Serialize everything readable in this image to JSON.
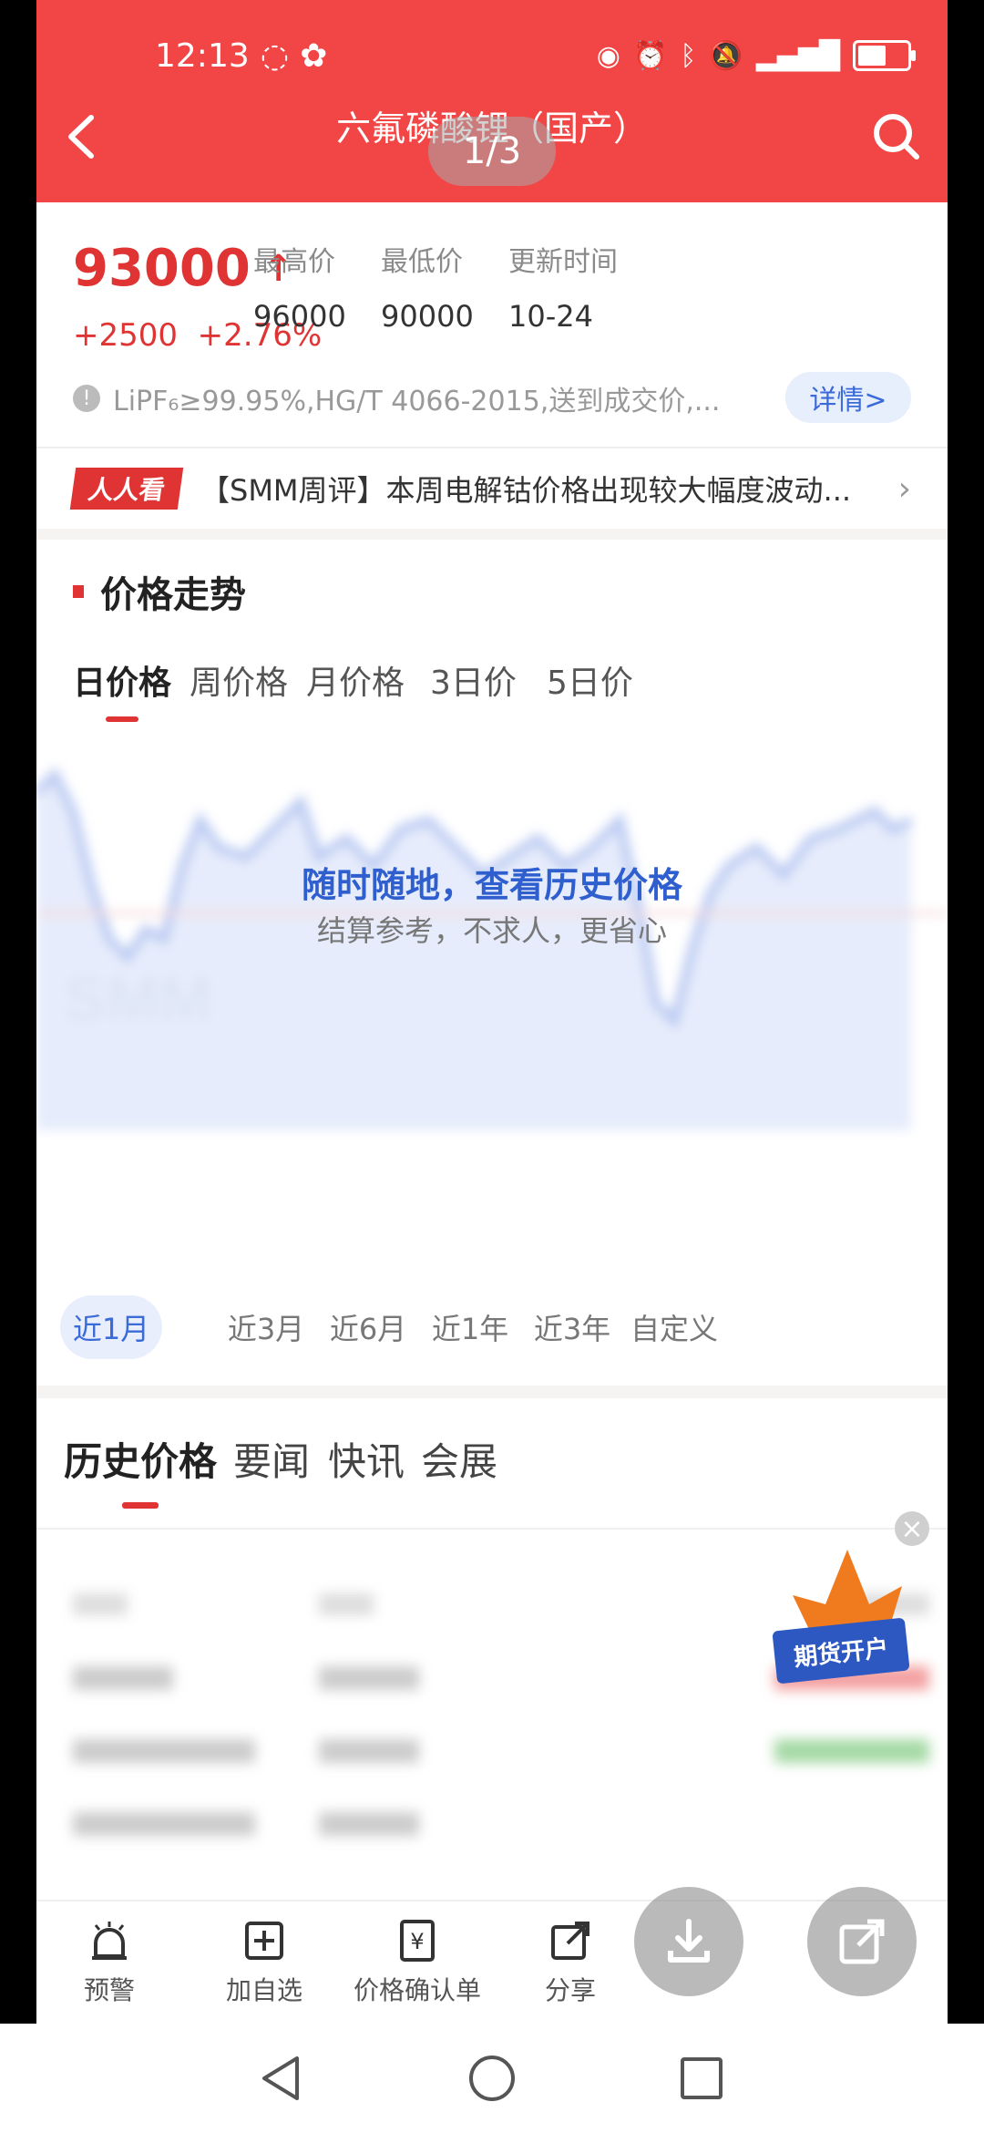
{
  "status_bar": {
    "time": "12:13"
  },
  "header": {
    "title": "六氟磷酸锂（国产）",
    "page_counter": "1/3"
  },
  "price_block": {
    "price": "93000",
    "arrow": "↑",
    "change": "+2500",
    "change_pct": "+2.76%",
    "stats": [
      {
        "label": "最高价",
        "value": "96000"
      },
      {
        "label": "最低价",
        "value": "90000"
      },
      {
        "label": "更新时间",
        "value": "10-24"
      }
    ],
    "spec_text": "LiPF₆≥99.95%,HG/T 4066-2015,送到成交价,...",
    "detail_button": "详情>"
  },
  "news_ticker": {
    "tag": "人人看",
    "text": "【SMM周评】本周电解钴价格出现较大幅度波动..."
  },
  "trend": {
    "title": "价格走势",
    "tabs": [
      "日价格",
      "周价格",
      "月价格",
      "3日价",
      "5日价"
    ],
    "active_tab": 0,
    "promo_title": "随时随地，查看历史价格",
    "promo_subtitle": "结算参考，不求人，更省心",
    "ranges": [
      "近1月",
      "近3月",
      "近6月",
      "近1年",
      "近3年",
      "自定义"
    ],
    "active_range": 0
  },
  "history": {
    "tabs": [
      "历史价格",
      "要闻",
      "快讯",
      "会展"
    ],
    "active_tab": 0,
    "float_label": "期货开户"
  },
  "bottom_nav": {
    "items": [
      {
        "label": "预警",
        "icon": "alarm-bell-icon"
      },
      {
        "label": "加自选",
        "icon": "add-watchlist-icon"
      },
      {
        "label": "价格确认单",
        "icon": "price-confirm-icon"
      },
      {
        "label": "分享",
        "icon": "share-icon"
      }
    ]
  },
  "colors": {
    "brand_red": "#f24545",
    "accent_blue": "#3a6bd8"
  }
}
